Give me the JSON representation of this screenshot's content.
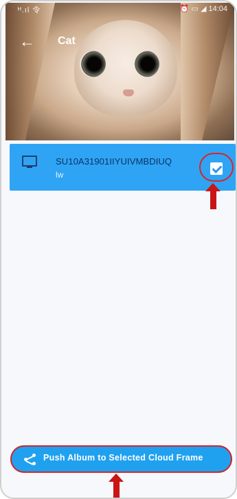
{
  "status_bar": {
    "left": "ᴴ.ıl 令",
    "right": "⏰ ▭ ◢ 14:04"
  },
  "header": {
    "title": "Cat"
  },
  "device": {
    "name": "SU10A31901IIYUIVMBDIUQ",
    "subtitle": "lw",
    "selected": true
  },
  "action": {
    "push_label": "Push Album to Selected Cloud Frame"
  },
  "icons": {
    "back": "back-arrow-icon",
    "device": "monitor-icon",
    "share": "share-icon",
    "check": "checkbox-checked-icon"
  },
  "colors": {
    "accent": "#20a1f0",
    "device_row": "#2fa4f4",
    "highlight": "#d42429"
  }
}
